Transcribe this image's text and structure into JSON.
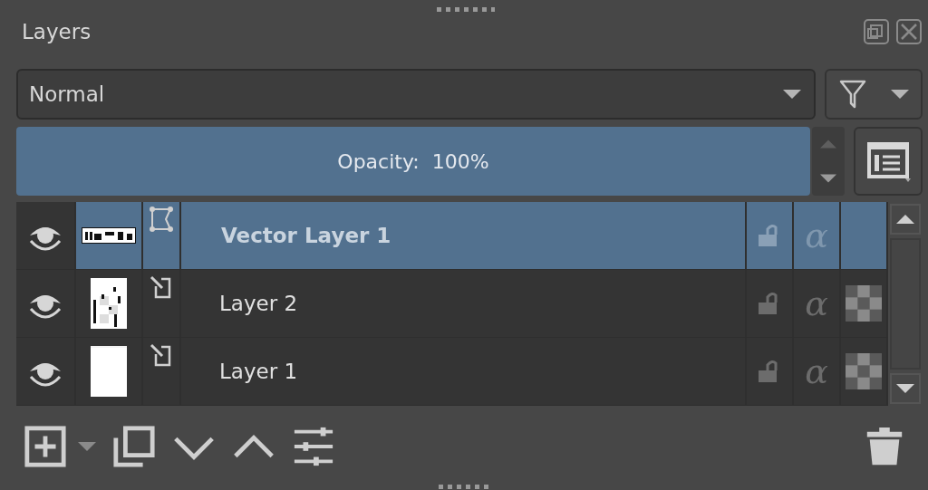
{
  "docker": {
    "title": "Layers"
  },
  "blend_mode": {
    "value": "Normal"
  },
  "opacity": {
    "label": "Opacity:",
    "reading": "100%",
    "level": 1
  },
  "layers": [
    {
      "name": "Vector Layer 1",
      "kind": "vector",
      "selected": true,
      "visible": true,
      "locked": false,
      "alpha": "α",
      "inherit_alpha": false
    },
    {
      "name": "Layer 2",
      "kind": "paint",
      "selected": false,
      "visible": true,
      "locked": false,
      "alpha": "α",
      "inherit_alpha": true
    },
    {
      "name": "Layer 1",
      "kind": "paint",
      "selected": false,
      "visible": true,
      "locked": false,
      "alpha": "α",
      "inherit_alpha": true
    }
  ]
}
